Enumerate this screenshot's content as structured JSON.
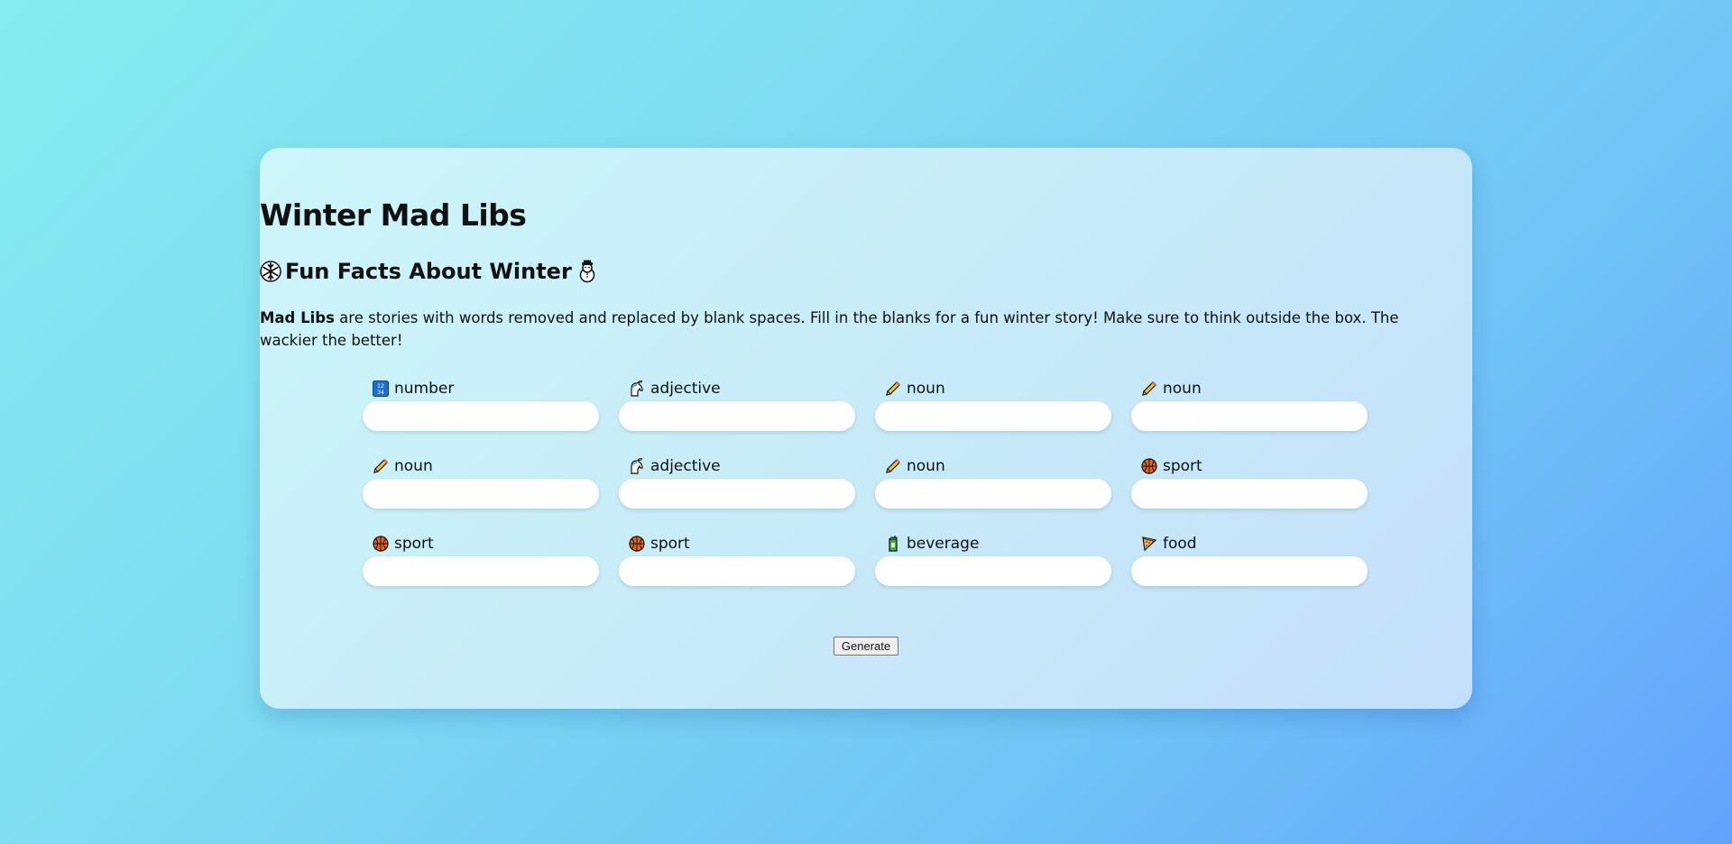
{
  "page": {
    "title": "Winter Mad Libs",
    "subtitle": "Fun Facts About Winter",
    "subtitle_icons": [
      "snowflake-icon",
      "snowman-icon"
    ],
    "intro_bold": "Mad Libs",
    "intro_text": " are stories with words removed and replaced by blank spaces. Fill in the blanks for a fun winter story! Make sure to think outside the box. The wackier the better!"
  },
  "fields": [
    {
      "label": "number",
      "icon": "number-icon",
      "value": ""
    },
    {
      "label": "adjective",
      "icon": "unicorn-icon",
      "value": ""
    },
    {
      "label": "noun",
      "icon": "pencil-icon",
      "value": ""
    },
    {
      "label": "noun",
      "icon": "pencil-icon",
      "value": ""
    },
    {
      "label": "noun",
      "icon": "pencil-icon",
      "value": ""
    },
    {
      "label": "adjective",
      "icon": "unicorn-icon",
      "value": ""
    },
    {
      "label": "noun",
      "icon": "pencil-icon",
      "value": ""
    },
    {
      "label": "sport",
      "icon": "basketball-icon",
      "value": ""
    },
    {
      "label": "sport",
      "icon": "basketball-icon",
      "value": ""
    },
    {
      "label": "sport",
      "icon": "basketball-icon",
      "value": ""
    },
    {
      "label": "beverage",
      "icon": "beverage-box-icon",
      "value": ""
    },
    {
      "label": "food",
      "icon": "pizza-icon",
      "value": ""
    }
  ],
  "actions": {
    "generate_label": "Generate"
  },
  "colors": {
    "background_start": "#86ecf0",
    "background_end": "#64a3fd",
    "card_start": "#cdf6fa",
    "card_end": "#c4dffb"
  }
}
